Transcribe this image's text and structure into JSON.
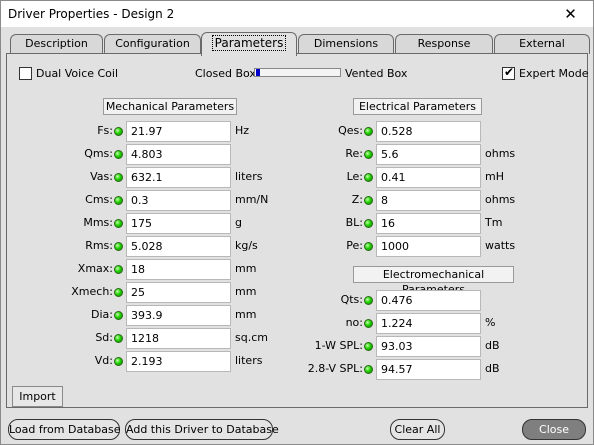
{
  "window": {
    "title": "Driver Properties - Design 2",
    "close_glyph": "✕"
  },
  "tabs": [
    {
      "label": "Description",
      "active": false
    },
    {
      "label": "Configuration",
      "active": false
    },
    {
      "label": "Parameters",
      "active": true
    },
    {
      "label": "Dimensions",
      "active": false
    },
    {
      "label": "Response",
      "active": false
    },
    {
      "label": "External",
      "active": false
    }
  ],
  "options": {
    "dual_voice_coil_label": "Dual Voice Coil",
    "dual_voice_coil_checked": false,
    "closed_box_label": "Closed Box",
    "vented_box_label": "Vented Box",
    "box_slider_fraction": 0.0,
    "expert_mode_label": "Expert Mode",
    "expert_mode_checked": true,
    "check_glyph": "✔"
  },
  "mechanical": {
    "header": "Mechanical Parameters",
    "params": [
      {
        "label": "Fs:",
        "value": "21.97",
        "unit": "Hz"
      },
      {
        "label": "Qms:",
        "value": "4.803",
        "unit": ""
      },
      {
        "label": "Vas:",
        "value": "632.1",
        "unit": "liters"
      },
      {
        "label": "Cms:",
        "value": "0.3",
        "unit": "mm/N"
      },
      {
        "label": "Mms:",
        "value": "175",
        "unit": "g"
      },
      {
        "label": "Rms:",
        "value": "5.028",
        "unit": "kg/s"
      },
      {
        "label": "Xmax:",
        "value": "18",
        "unit": "mm"
      },
      {
        "label": "Xmech:",
        "value": "25",
        "unit": "mm"
      },
      {
        "label": "Dia:",
        "value": "393.9",
        "unit": "mm"
      },
      {
        "label": "Sd:",
        "value": "1218",
        "unit": "sq.cm"
      },
      {
        "label": "Vd:",
        "value": "2.193",
        "unit": "liters"
      }
    ]
  },
  "electrical": {
    "header": "Electrical Parameters",
    "params": [
      {
        "label": "Qes:",
        "value": "0.528",
        "unit": ""
      },
      {
        "label": "Re:",
        "value": "5.6",
        "unit": "ohms"
      },
      {
        "label": "Le:",
        "value": "0.41",
        "unit": "mH"
      },
      {
        "label": "Z:",
        "value": "8",
        "unit": "ohms"
      },
      {
        "label": "BL:",
        "value": "16",
        "unit": "Tm"
      },
      {
        "label": "Pe:",
        "value": "1000",
        "unit": "watts"
      }
    ]
  },
  "electromechanical": {
    "header": "Electromechanical Parameters",
    "params": [
      {
        "label": "Qts:",
        "value": "0.476",
        "unit": ""
      },
      {
        "label": "no:",
        "value": "1.224",
        "unit": "%"
      },
      {
        "label": "1-W SPL:",
        "value": "93.03",
        "unit": "dB"
      },
      {
        "label": "2.8-V SPL:",
        "value": "94.57",
        "unit": "dB"
      }
    ]
  },
  "buttons": {
    "import": "Import",
    "load_from_db": "Load from Database",
    "add_to_db": "Add this Driver to Database",
    "clear_all": "Clear All",
    "close": "Close"
  }
}
